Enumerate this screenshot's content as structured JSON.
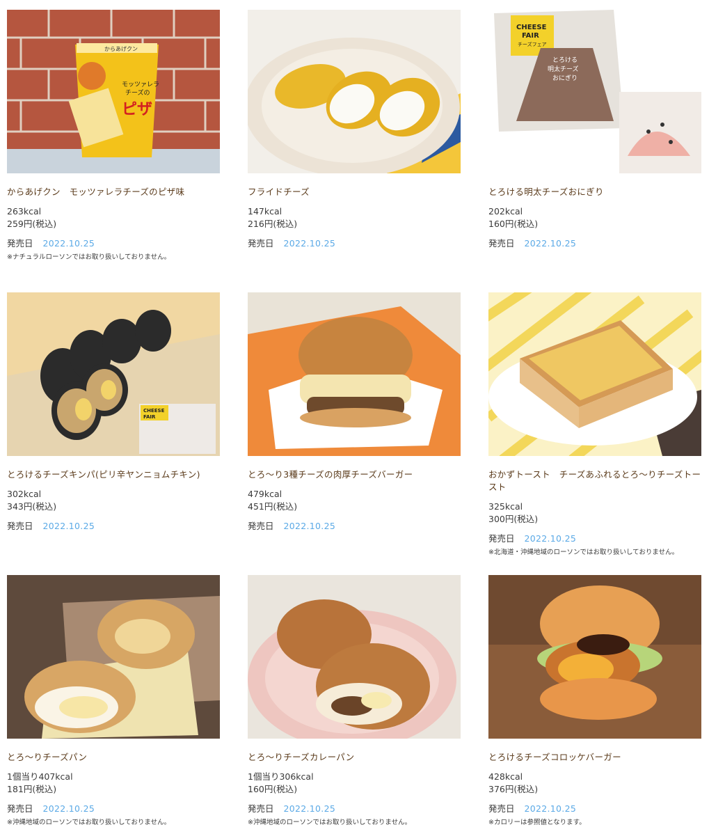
{
  "release_label": "発売日",
  "products": [
    {
      "name": "からあげクン　モッツァレラチーズのピザ味",
      "kcal": "263kcal",
      "price": "259円(税込)",
      "date": "2022.10.25",
      "note": "※ナチュラルローソンではお取り扱いしておりません。",
      "package_text": [
        "からあげクン",
        "モッツァレラ",
        "チーズの",
        "ピザ"
      ]
    },
    {
      "name": "フライドチーズ",
      "kcal": "147kcal",
      "price": "216円(税込)",
      "date": "2022.10.25",
      "note": ""
    },
    {
      "name": "とろける明太チーズおにぎり",
      "kcal": "202kcal",
      "price": "160円(税込)",
      "date": "2022.10.25",
      "note": "",
      "package_text": [
        "CHEESE",
        "FAIR",
        "チーズフェア",
        "とろける",
        "明太チーズ",
        "おにぎり"
      ]
    },
    {
      "name": "とろけるチーズキンパ(ピリ辛ヤンニョムチキン)",
      "kcal": "302kcal",
      "price": "343円(税込)",
      "date": "2022.10.25",
      "note": "",
      "package_text": [
        "CHEESE",
        "FAIR"
      ]
    },
    {
      "name": "とろ～り3種チーズの肉厚チーズバーガー",
      "kcal": "479kcal",
      "price": "451円(税込)",
      "date": "2022.10.25",
      "note": ""
    },
    {
      "name": "おかずトースト　チーズあふれるとろ～りチーズトースト",
      "kcal": "325kcal",
      "price": "300円(税込)",
      "date": "2022.10.25",
      "note": "※北海道・沖縄地域のローソンではお取り扱いしておりません。"
    },
    {
      "name": "とろ～りチーズパン",
      "kcal": "1個当り407kcal",
      "price": "181円(税込)",
      "date": "2022.10.25",
      "note": "※沖縄地域のローソンではお取り扱いしておりません。"
    },
    {
      "name": "とろ～りチーズカレーパン",
      "kcal": "1個当り306kcal",
      "price": "160円(税込)",
      "date": "2022.10.25",
      "note": "※沖縄地域のローソンではお取り扱いしておりません。"
    },
    {
      "name": "とろけるチーズコロッケバーガー",
      "kcal": "428kcal",
      "price": "376円(税込)",
      "date": "2022.10.25",
      "note": "※カロリーは参照値となります。"
    }
  ]
}
